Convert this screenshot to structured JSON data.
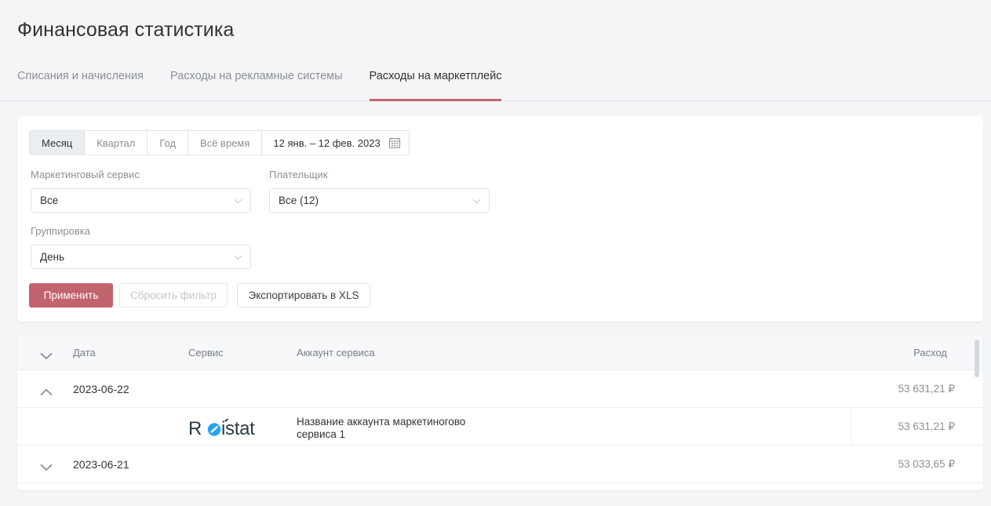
{
  "header": {
    "title": "Финансовая статистика",
    "tabs": [
      {
        "label": "Списания и начисления",
        "active": false
      },
      {
        "label": "Расходы на рекламные системы",
        "active": false
      },
      {
        "label": "Расходы на маркетплейс",
        "active": true
      }
    ]
  },
  "filters": {
    "period_segments": [
      {
        "label": "Месяц",
        "active": true
      },
      {
        "label": "Квартал",
        "active": false
      },
      {
        "label": "Год",
        "active": false
      },
      {
        "label": "Всё время",
        "active": false
      }
    ],
    "date_range": "12 янв. – 12 фев. 2023",
    "calendar_icon": "calendar-icon",
    "marketing_service": {
      "label": "Маркетинговый сервис",
      "value": "Все"
    },
    "payer": {
      "label": "Плательщик",
      "value": "Все (12)"
    },
    "grouping": {
      "label": "Группировка",
      "value": "День"
    },
    "buttons": {
      "apply": "Применить",
      "reset": "Сбросить фильтр",
      "export": "Экспортировать в XLS"
    }
  },
  "table": {
    "columns": [
      "Дата",
      "Сервис",
      "Аккаунт сервиса",
      "Расход"
    ],
    "header_chevron": "chevron-down-icon",
    "rows": [
      {
        "type": "group",
        "chevron": "chevron-up-icon",
        "date": "2023-06-22",
        "amount": "53 631,21 ₽"
      },
      {
        "type": "detail",
        "logo": "roistat-logo",
        "account": "Название аккаунта маркетиногово сервиса 1",
        "amount": "53 631,21 ₽"
      },
      {
        "type": "group",
        "chevron": "chevron-down-icon",
        "date": "2023-06-21",
        "amount": "53 033,65 ₽"
      }
    ]
  },
  "colors": {
    "accent": "#c2636e",
    "page_bg": "#f3f5f6",
    "text": "#2f3334",
    "muted": "#8a9095",
    "logo_blue": "#22a4f0",
    "logo_dark": "#2b3a4a"
  }
}
